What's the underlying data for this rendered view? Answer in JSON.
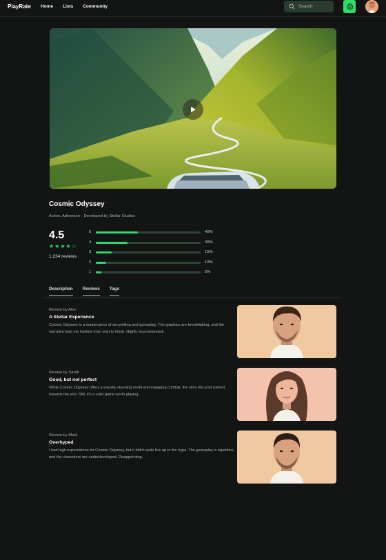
{
  "header": {
    "logo": "PlayRate",
    "nav": [
      "Home",
      "Lists",
      "Community"
    ],
    "search_placeholder": "Search",
    "icons": [
      "search-icon",
      "gear-icon",
      "avatar"
    ],
    "accent": "#2ddc69"
  },
  "game": {
    "title": "Cosmic Odyssey",
    "meta": "Action, Adventure · Developed by Stellar Studios",
    "rating": "4.5",
    "stars": 4,
    "reviews_count": "1,234 reviews",
    "distribution": [
      {
        "stars": "5",
        "pct": "40%",
        "value": 40
      },
      {
        "stars": "4",
        "pct": "30%",
        "value": 30
      },
      {
        "stars": "3",
        "pct": "15%",
        "value": 15
      },
      {
        "stars": "2",
        "pct": "10%",
        "value": 10
      },
      {
        "stars": "1",
        "pct": "5%",
        "value": 5
      }
    ]
  },
  "tabs": [
    "Description",
    "Reviews",
    "Tags"
  ],
  "reviews": [
    {
      "by": "Review by Alex",
      "title": "A Stellar Experience",
      "text": "Cosmic Odyssey is a masterpiece of storytelling and gameplay. The graphics are breathtaking, and the narrative kept me hooked from start to finish. Highly recommended!"
    },
    {
      "by": "Review by Sarah",
      "title": "Good, but not perfect",
      "text": "While Cosmic Odyssey offers a visually stunning world and engaging combat, the story felt a bit rushed towards the end. Still, it's a solid game worth playing."
    },
    {
      "by": "Review by Mark",
      "title": "Overhyped",
      "text": "I had high expectations for Cosmic Odyssey, but it didn't quite live up to the hype. The gameplay is repetitive, and the characters are underdeveloped. Disappointing."
    }
  ]
}
